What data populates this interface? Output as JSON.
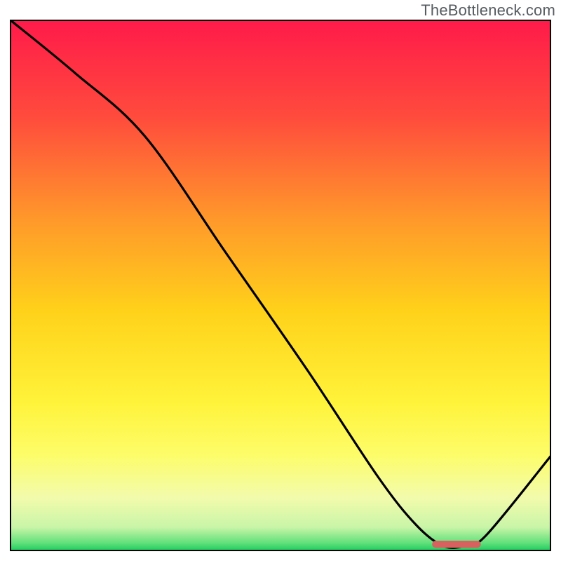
{
  "watermark": "TheBottleneck.com",
  "chart_data": {
    "type": "line",
    "title": "",
    "xlabel": "",
    "ylabel": "",
    "xlim": [
      0,
      100
    ],
    "ylim": [
      0,
      100
    ],
    "grid": false,
    "series": [
      {
        "name": "curve",
        "x": [
          0,
          12,
          25,
          40,
          55,
          68,
          75,
          80,
          84,
          88,
          100
        ],
        "y": [
          100,
          90,
          78,
          56,
          34,
          14,
          5,
          1,
          1,
          3,
          18
        ]
      }
    ],
    "marker": {
      "name": "optimal-range",
      "x_start": 78,
      "x_end": 87,
      "y": 1.3,
      "color": "#d6615f"
    },
    "background_gradient": {
      "stops": [
        {
          "offset": 0,
          "color": "#ff1a4a"
        },
        {
          "offset": 0.18,
          "color": "#ff4a3d"
        },
        {
          "offset": 0.38,
          "color": "#ff9a2a"
        },
        {
          "offset": 0.55,
          "color": "#ffd21a"
        },
        {
          "offset": 0.72,
          "color": "#fff33a"
        },
        {
          "offset": 0.82,
          "color": "#fdfd6a"
        },
        {
          "offset": 0.9,
          "color": "#f2fbac"
        },
        {
          "offset": 0.955,
          "color": "#c9f5a8"
        },
        {
          "offset": 0.985,
          "color": "#5fe07a"
        },
        {
          "offset": 1.0,
          "color": "#17c95c"
        }
      ]
    },
    "frame_color": "#000000"
  }
}
